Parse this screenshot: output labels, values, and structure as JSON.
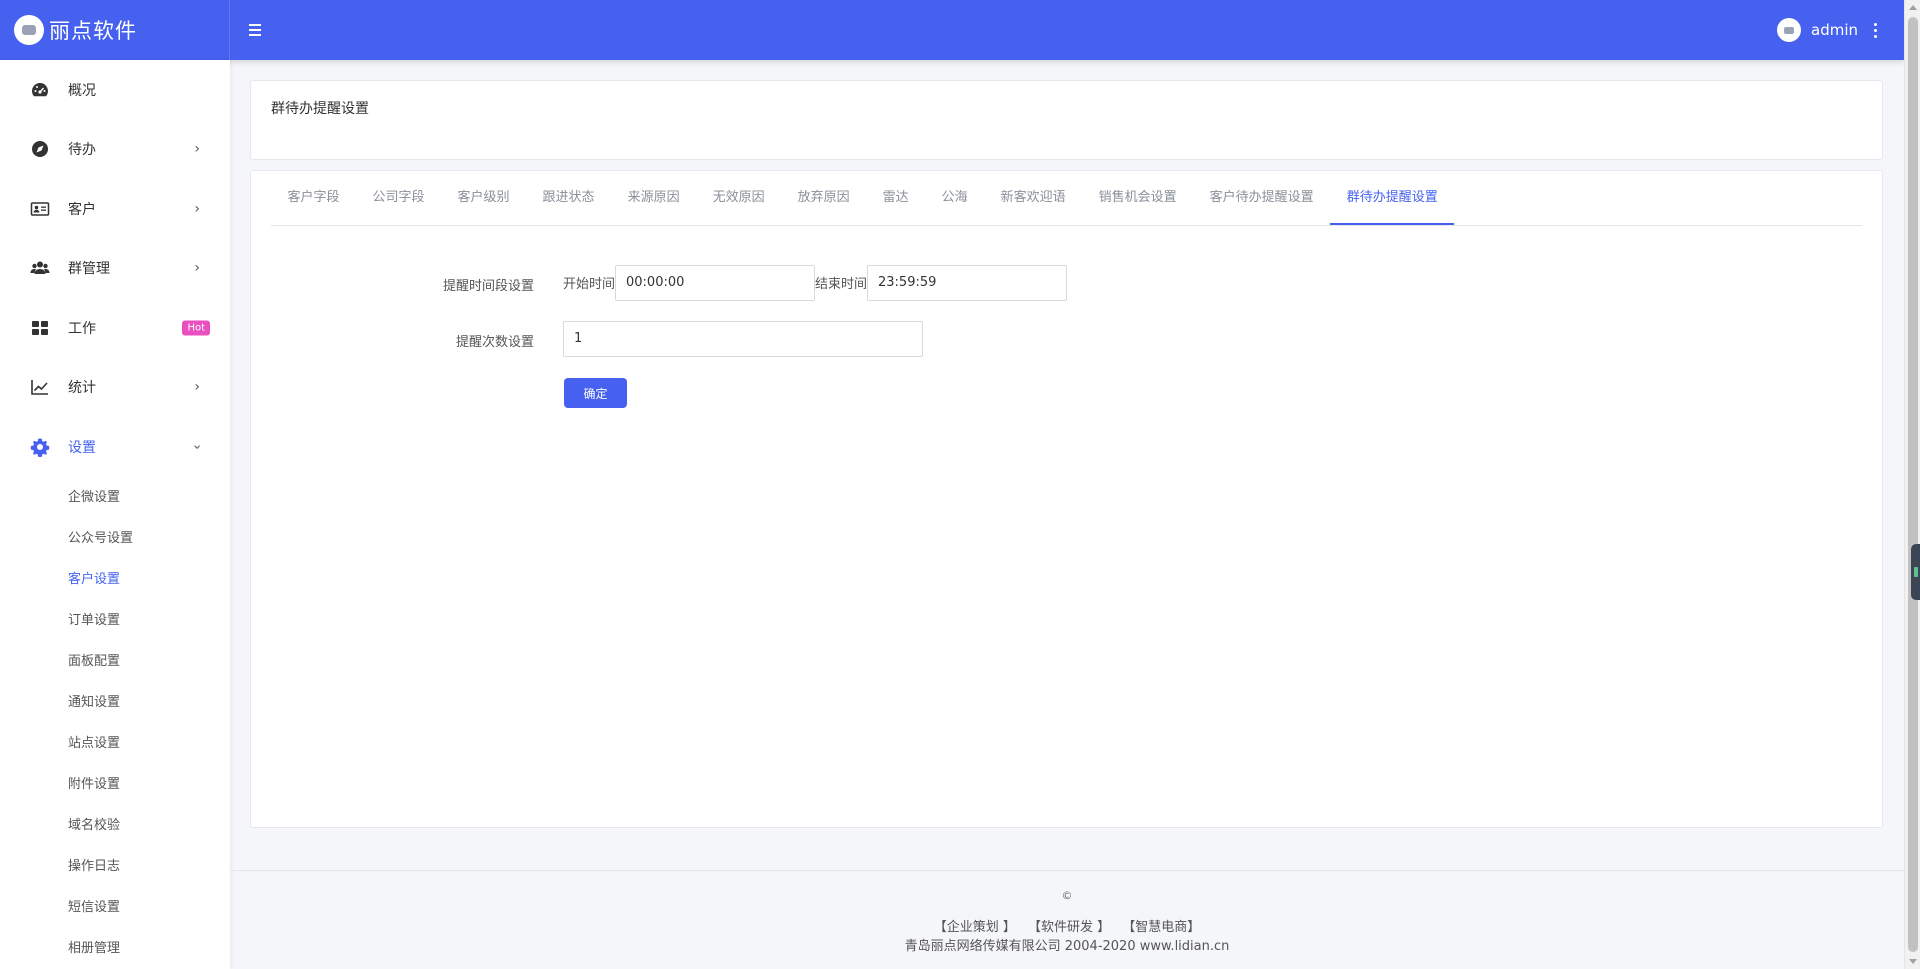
{
  "brand": {
    "name": "丽点软件"
  },
  "user": {
    "name": "admin"
  },
  "sidebar": {
    "items": [
      {
        "label": "概况",
        "icon": "dashboard-icon"
      },
      {
        "label": "待办",
        "icon": "compass-icon"
      },
      {
        "label": "客户",
        "icon": "id-card-icon"
      },
      {
        "label": "群管理",
        "icon": "users-icon"
      },
      {
        "label": "工作",
        "icon": "grid-icon",
        "badge": "Hot"
      },
      {
        "label": "统计",
        "icon": "chart-line-icon"
      },
      {
        "label": "设置",
        "icon": "gear-icon"
      }
    ],
    "settings_subitems": [
      "企微设置",
      "公众号设置",
      "客户设置",
      "订单设置",
      "面板配置",
      "通知设置",
      "站点设置",
      "附件设置",
      "域名校验",
      "操作日志",
      "短信设置",
      "相册管理"
    ],
    "active_subitem": "客户设置"
  },
  "page": {
    "title": "群待办提醒设置"
  },
  "tabs": [
    "客户字段",
    "公司字段",
    "客户级别",
    "跟进状态",
    "来源原因",
    "无效原因",
    "放弃原因",
    "雷达",
    "公海",
    "新客欢迎语",
    "销售机会设置",
    "客户待办提醒设置",
    "群待办提醒设置"
  ],
  "active_tab": "群待办提醒设置",
  "form": {
    "time_label": "提醒时间段设置",
    "start_label": "开始时间",
    "start_value": "00:00:00",
    "end_label": "结束时间",
    "end_value": "23:59:59",
    "count_label": "提醒次数设置",
    "count_value": "1",
    "submit_label": "确定"
  },
  "footer": {
    "copyright": "©",
    "links": [
      "【企业策划 】",
      "【软件研发 】",
      "【智慧电商】"
    ],
    "company": "青岛丽点网络传媒有限公司 2004-2020 www.lidian.cn"
  },
  "colors": {
    "primary": "#4661f0",
    "hot_badge": "#ea4fbf"
  }
}
